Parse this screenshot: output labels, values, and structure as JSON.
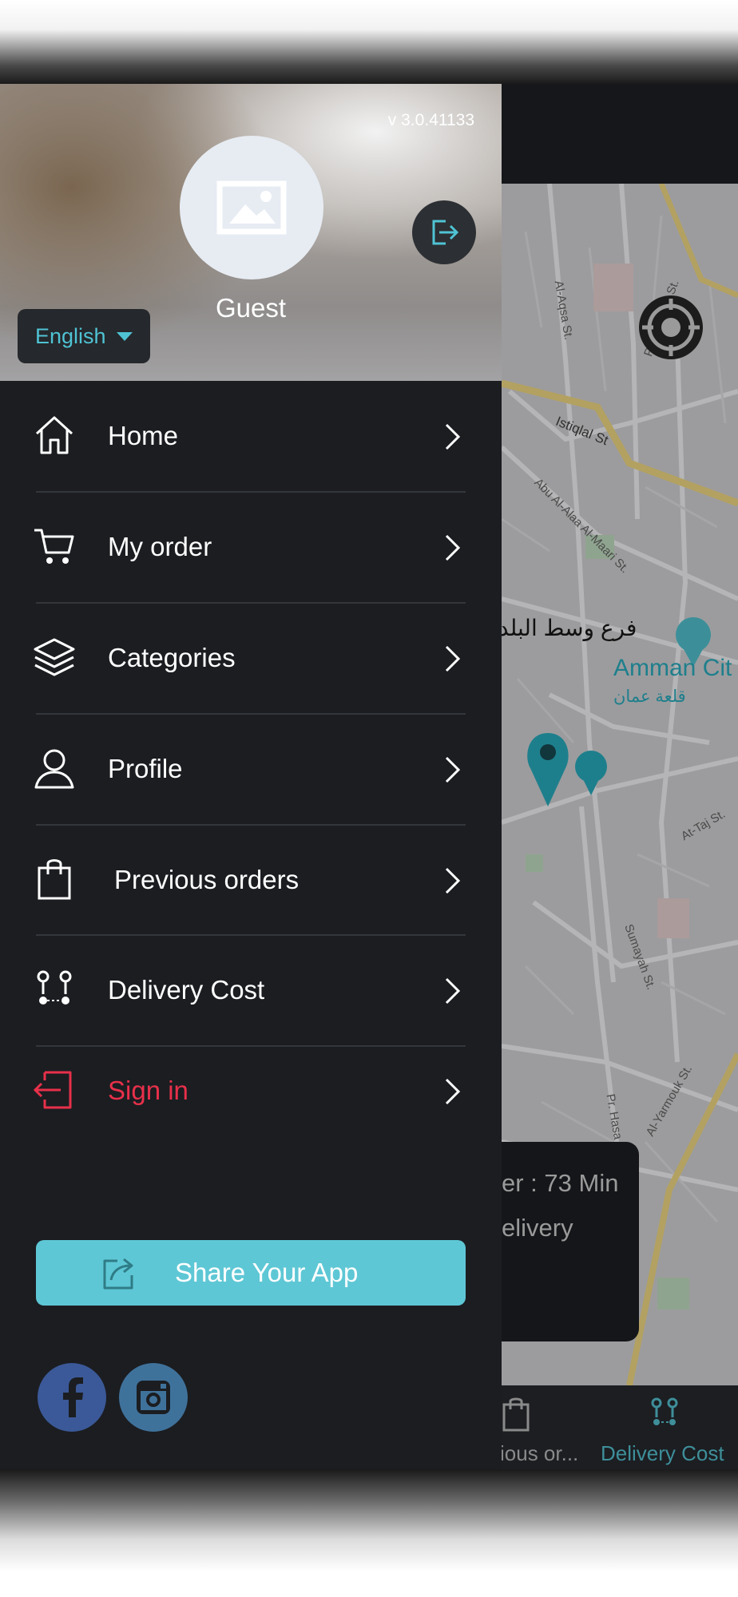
{
  "drawer": {
    "version": "v 3.0.41133",
    "user_name": "Guest",
    "language": "English",
    "menu": [
      {
        "label": "Home",
        "icon": "home-icon"
      },
      {
        "label": "My order",
        "icon": "cart-icon"
      },
      {
        "label": "Categories",
        "icon": "layers-icon"
      },
      {
        "label": "Profile",
        "icon": "user-icon"
      },
      {
        "label": "Previous orders",
        "icon": "shopping-bag-icon"
      },
      {
        "label": "Delivery Cost",
        "icon": "route-icon"
      },
      {
        "label": "Sign in",
        "icon": "sign-in-icon"
      }
    ],
    "share_label": "Share Your App",
    "social": [
      "facebook-icon",
      "instagram-icon"
    ]
  },
  "background_app": {
    "map_labels": {
      "street1": "Al-Aqsa St.",
      "street2": "Pr. Hamzah St.",
      "street3": "Istiqlal St",
      "street4": "Abu Al-Alaa Al-Maari St.",
      "place_arabic": "فرع وسط البلد",
      "landmark": "Amman Cit",
      "landmark_arabic": "قلعة عمان",
      "street5": "At-Taj St.",
      "street6": "Sumayah St.",
      "street7": "Pr. Hasa",
      "street8": "Al-Yarmouk St."
    },
    "eta_line1": "er : 73 Min",
    "eta_line2": "elivery",
    "bottom_nav": [
      {
        "label": "ious or...",
        "icon": "shopping-bag-icon",
        "active": false
      },
      {
        "label": "Delivery Cost",
        "icon": "route-icon",
        "active": true
      }
    ]
  },
  "colors": {
    "accent": "#5ec7d5",
    "sign_in": "#e8304a",
    "drawer_bg": "#1b1d21",
    "facebook": "#3b5998",
    "instagram": "#3f729b"
  }
}
